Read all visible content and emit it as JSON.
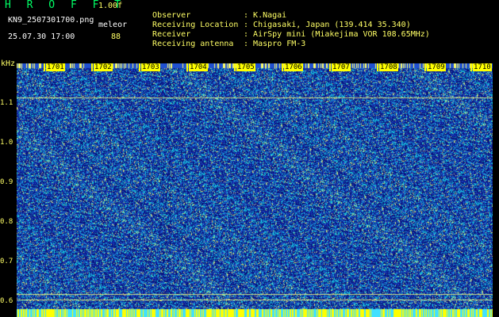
{
  "header": {
    "title": "H R O F F T",
    "version": "1.00f",
    "filename": "KN9_2507301700.png",
    "meleor_label": "meleor",
    "datetime": "25.07.30 17:00",
    "count": "88"
  },
  "meta": [
    {
      "key": "Observer",
      "sep": ":",
      "value": "K.Nagai"
    },
    {
      "key": "Receiving Location",
      "sep": ":",
      "value": "Chigasaki, Japan (139.414 35.340)"
    },
    {
      "key": "Receiver",
      "sep": ":",
      "value": "AirSpy mini (Miakejima VOR 108.65MHz)"
    },
    {
      "key": "Receiving antenna",
      "sep": ":",
      "value": "Maspro FM-3"
    }
  ],
  "axes": {
    "y_unit": "kHz",
    "y_ticks": [
      "1.1",
      "1.0",
      "0.9",
      "0.8",
      "0.7",
      "0.6"
    ],
    "x_ticks": [
      "1701",
      "1702",
      "1703",
      "1704",
      "1705",
      "1706",
      "1707",
      "1708",
      "1709",
      "1710"
    ]
  },
  "colors": {
    "background": "#000000",
    "waterfall_base": "#1a2a8a",
    "noise_cyan": "#00e0ff",
    "noise_yellow": "#ffff00",
    "tick_label": "#ffff66"
  }
}
